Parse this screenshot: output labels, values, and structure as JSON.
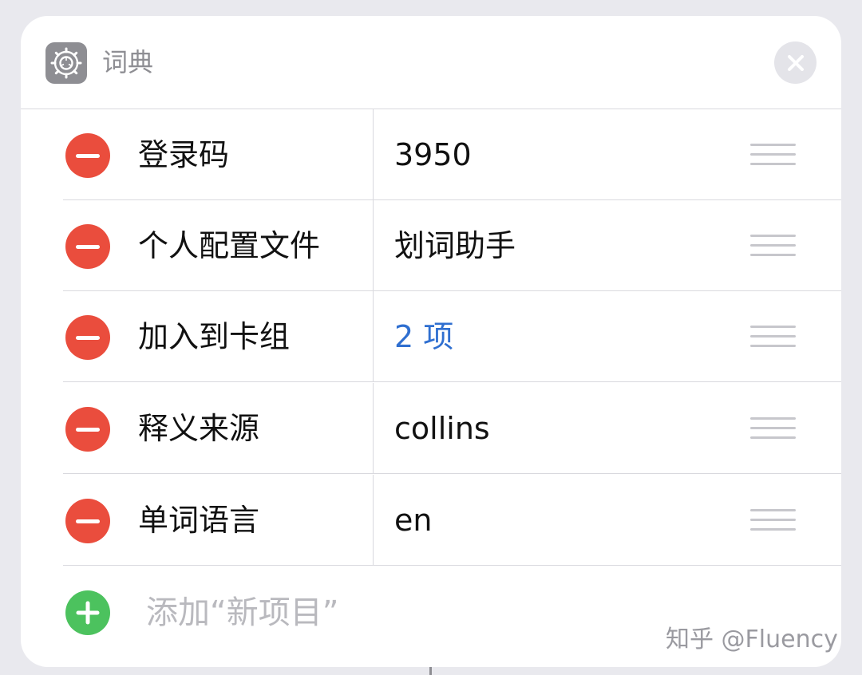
{
  "header": {
    "title": "词典",
    "app_icon": "gear-icon",
    "close_icon": "close-icon"
  },
  "rows": [
    {
      "key": "登录码",
      "value": "3950"
    },
    {
      "key": "个人配置文件",
      "value": "划词助手"
    },
    {
      "key": "加入到卡组",
      "value": "2 项",
      "value_color": "#2f6fd0"
    },
    {
      "key": "释义来源",
      "value": "collins"
    },
    {
      "key": "单词语言",
      "value": "en"
    }
  ],
  "add": {
    "label": "添加“新项目”"
  },
  "watermark": "知乎 @Fluency",
  "colors": {
    "remove": "#ea4d3d",
    "add": "#4cc25e",
    "link": "#2f6fd0"
  }
}
